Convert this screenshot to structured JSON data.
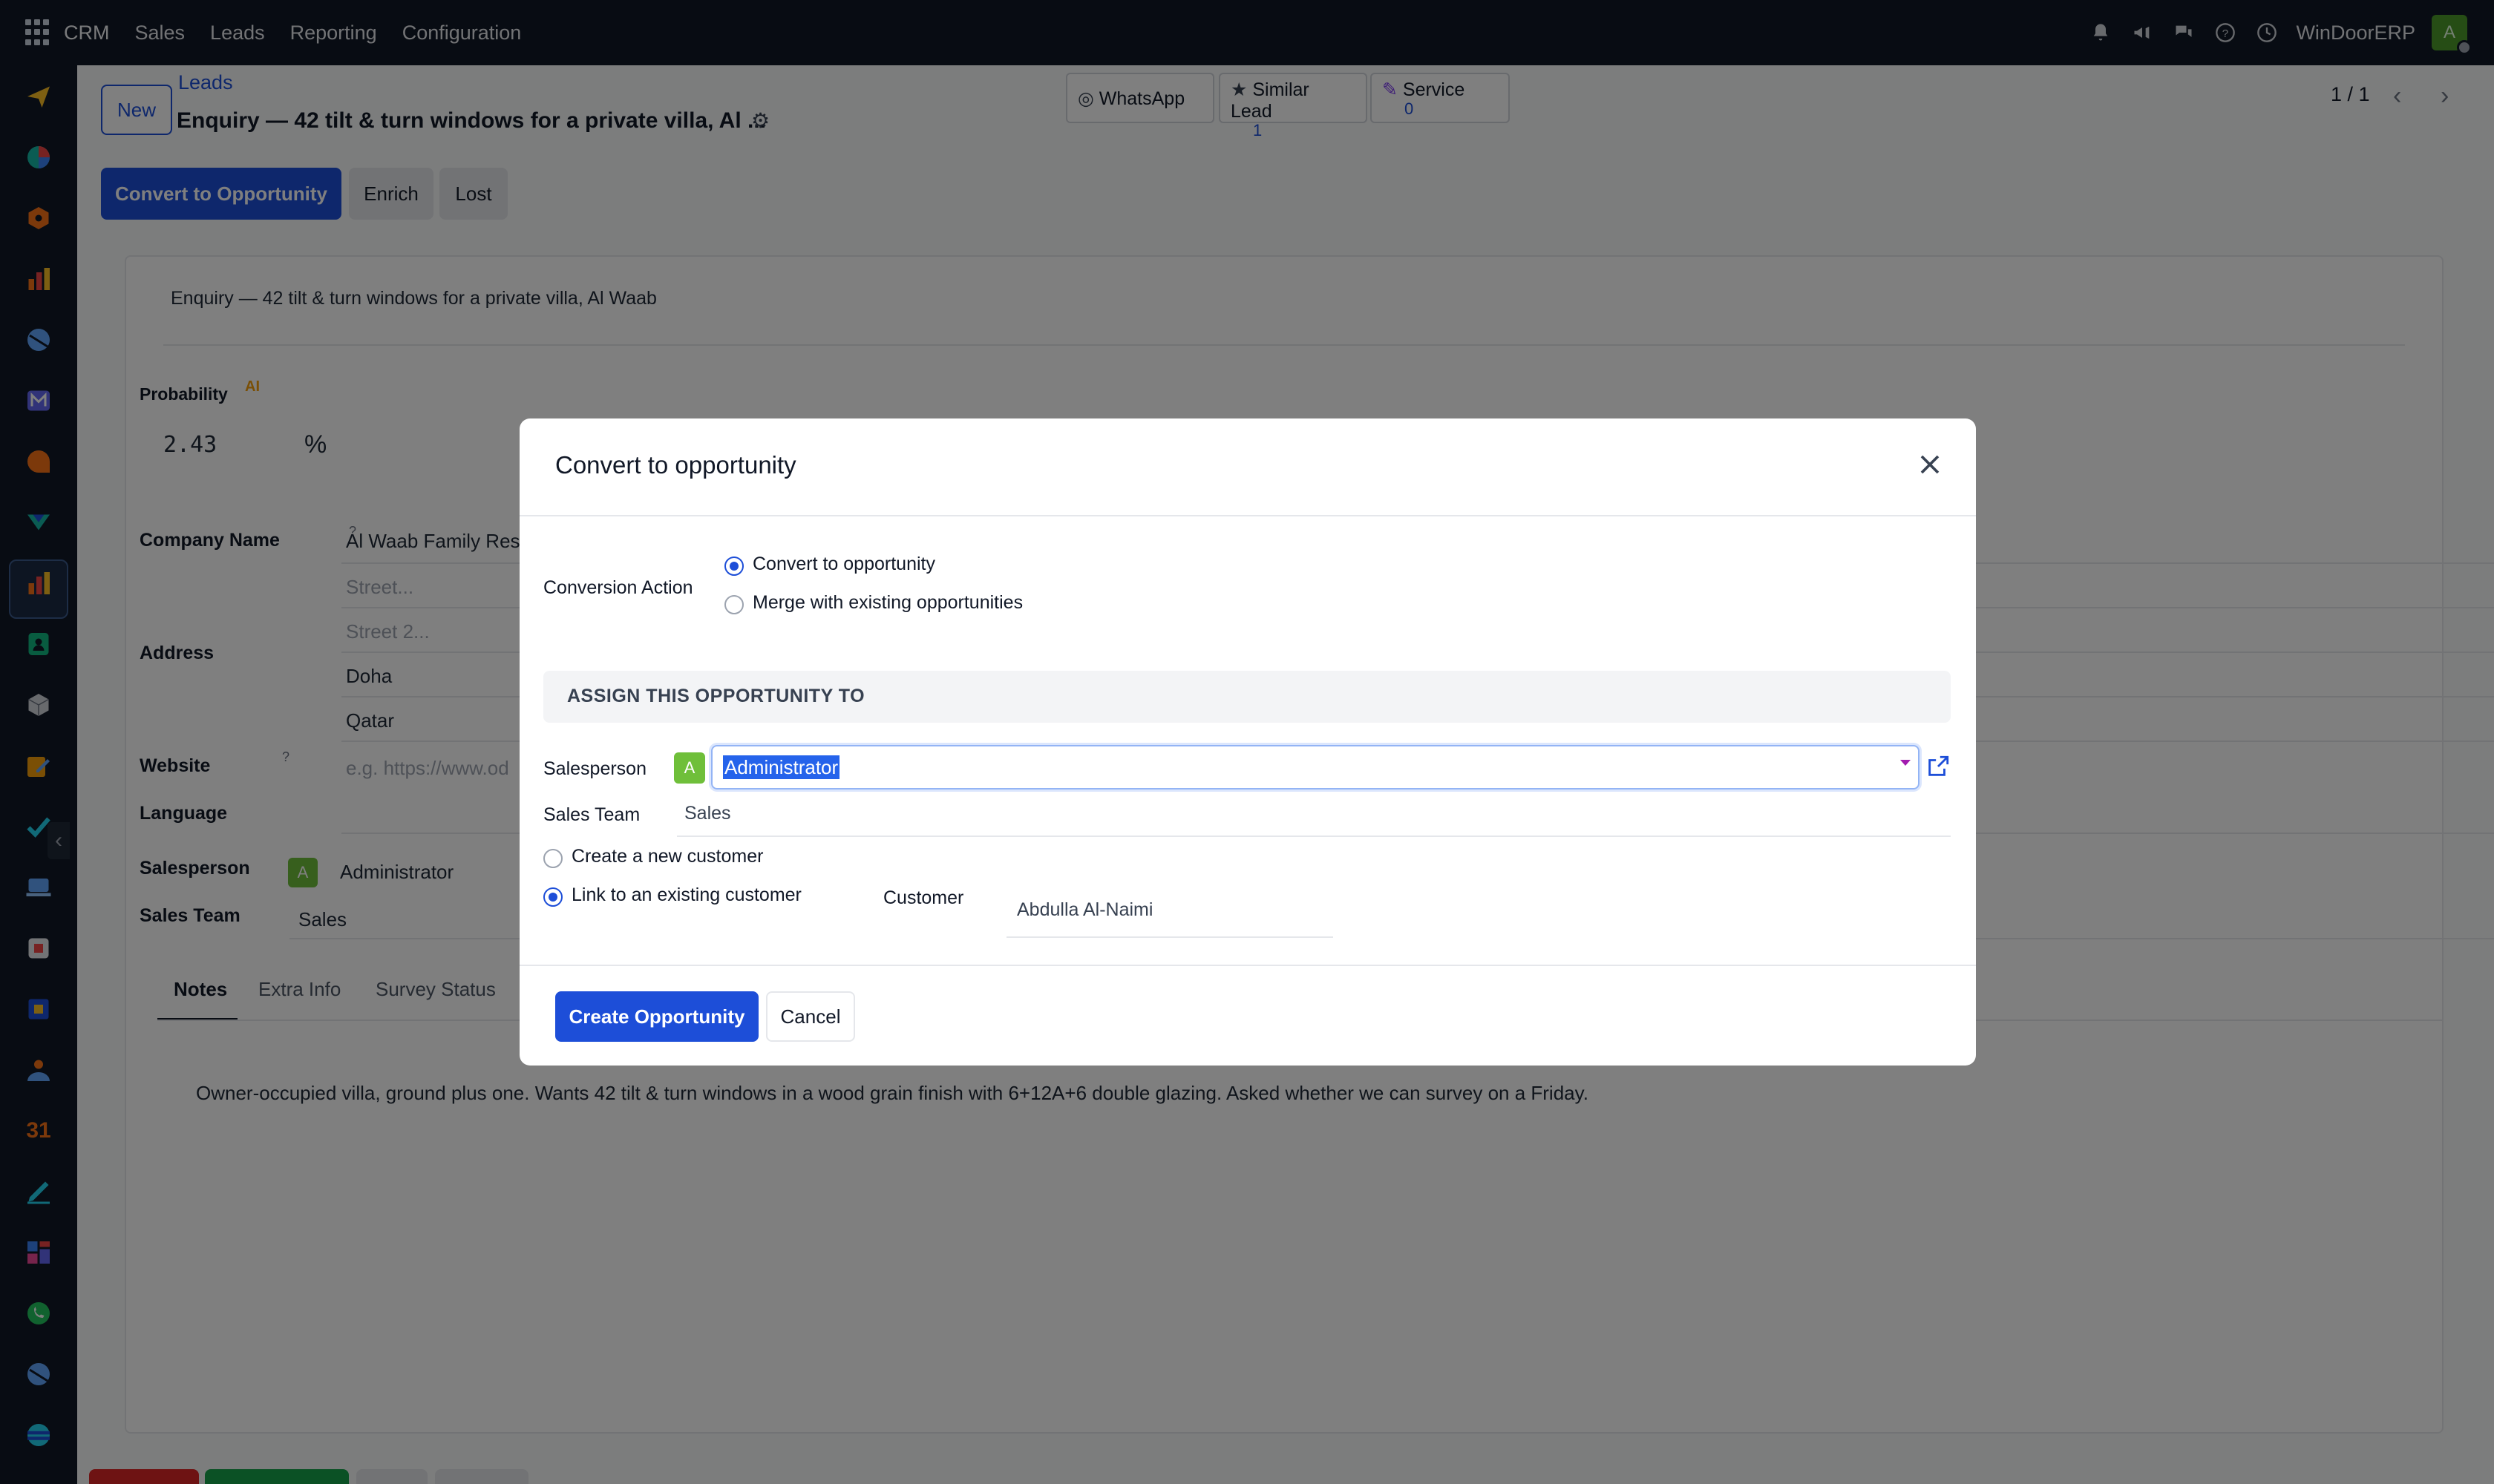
{
  "navbar": {
    "brand": "CRM",
    "menu": [
      "Sales",
      "Leads",
      "Reporting",
      "Configuration"
    ],
    "company": "WinDoorERP",
    "user_initial": "A",
    "icons": [
      "bell-icon",
      "megaphone-icon",
      "chat-icon",
      "help-icon",
      "clock-icon"
    ]
  },
  "sidebar": {
    "icons": [
      "send-icon",
      "chart-pie-icon",
      "hexagon-icon",
      "bar-chart-icon",
      "globe-icon",
      "mail-icon",
      "chat-bubble-icon",
      "crm-icon",
      "bar-chart-icon",
      "contacts-icon",
      "cube-icon",
      "edit-icon",
      "check-icon",
      "laptop-icon",
      "package-icon",
      "box-icon",
      "people-icon",
      "calendar-icon",
      "pen-icon",
      "dashboard-icon",
      "whatsapp-icon",
      "globe-icon",
      "layers-icon"
    ],
    "calendar_label": "31"
  },
  "control": {
    "new_label": "New",
    "breadcrumb": "Leads",
    "title": "Enquiry — 42 tilt & turn windows for a private villa, Al ...",
    "pager": "1 / 1"
  },
  "smart_buttons": {
    "whatsapp": "WhatsApp",
    "similar_label": "Similar Lead",
    "similar_count": "1",
    "service_label": "Service",
    "service_count": "0"
  },
  "statusbar": {
    "convert": "Convert to Opportunity",
    "enrich": "Enrich",
    "lost": "Lost"
  },
  "form": {
    "name": "Enquiry — 42 tilt & turn windows for a private villa, Al Waab",
    "probability_label": "Probability",
    "ai_badge": "AI",
    "probability": "2.43",
    "percent": "%",
    "company_label": "Company Name",
    "company_help": "?",
    "company": "Al Waab Family Res",
    "address_label": "Address",
    "street_ph": "Street...",
    "street2_ph": "Street 2...",
    "city": "Doha",
    "country": "Qatar",
    "website_label": "Website",
    "website_help": "?",
    "website_ph": "e.g. https://www.od",
    "language_label": "Language",
    "salesperson_label": "Salesperson",
    "salesperson": "Administrator",
    "sales_team_label": "Sales Team",
    "sales_team": "Sales",
    "tabs": [
      "Notes",
      "Extra Info",
      "Survey Status"
    ],
    "notes": "Owner-occupied villa, ground plus one. Wants 42 tilt & turn windows in a wood grain finish with 6+12A+6 double glazing. Asked whether we can survey on a Friday."
  },
  "modal": {
    "title": "Convert to opportunity",
    "conversion_action_label": "Conversion Action",
    "action_options": [
      "Convert to opportunity",
      "Merge with existing opportunities"
    ],
    "selected_action": "Convert to opportunity",
    "section_title": "ASSIGN THIS OPPORTUNITY TO",
    "salesperson_label": "Salesperson",
    "salesperson_initial": "A",
    "salesperson_value": "Administrator",
    "sales_team_label": "Sales Team",
    "sales_team_value": "Sales",
    "customer_options": [
      "Create a new customer",
      "Link to an existing customer"
    ],
    "selected_customer_option": "Link to an existing customer",
    "customer_label": "Customer",
    "customer_value": "Abdulla Al-Naimi",
    "create_button": "Create Opportunity",
    "cancel_button": "Cancel"
  },
  "colors": {
    "primary": "#1d4ed8",
    "navbar": "#111827",
    "avatar_green": "#6fbf3a"
  }
}
